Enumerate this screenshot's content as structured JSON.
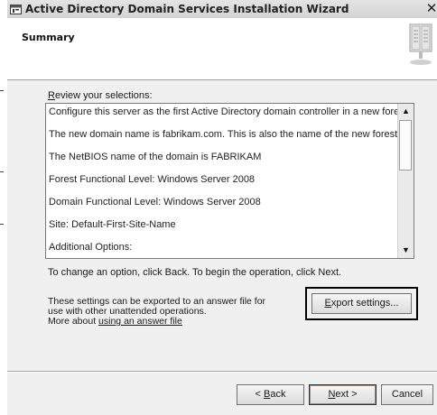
{
  "window": {
    "title": "Active Directory Domain Services Installation Wizard",
    "close_glyph": "✕"
  },
  "header": {
    "title": "Summary",
    "icon": "server-book-icon"
  },
  "review": {
    "label_mnemonic": "R",
    "label_rest": "eview your selections:",
    "lines": [
      "Configure this server as the first Active Directory domain controller in a new forest.",
      "The new domain name is fabrikam.com. This is also the name of the new forest.",
      "The NetBIOS name of the domain is FABRIKAM",
      "Forest Functional Level: Windows Server 2008",
      "Domain Functional Level: Windows Server 2008",
      "Site: Default-First-Site-Name",
      "Additional Options:"
    ]
  },
  "instructions": "To change an option, click Back. To begin the operation, click Next.",
  "export": {
    "description": "These settings can be exported to an answer file for use with other unattended operations.",
    "more_about": "More about ",
    "link_text": "using an answer file",
    "button_mnemonic": "E",
    "button_rest": "xport settings..."
  },
  "buttons": {
    "back_prefix": "< ",
    "back_mnemonic": "B",
    "back_rest": "ack",
    "next_mnemonic": "N",
    "next_rest": "ext >",
    "cancel": "Cancel"
  }
}
